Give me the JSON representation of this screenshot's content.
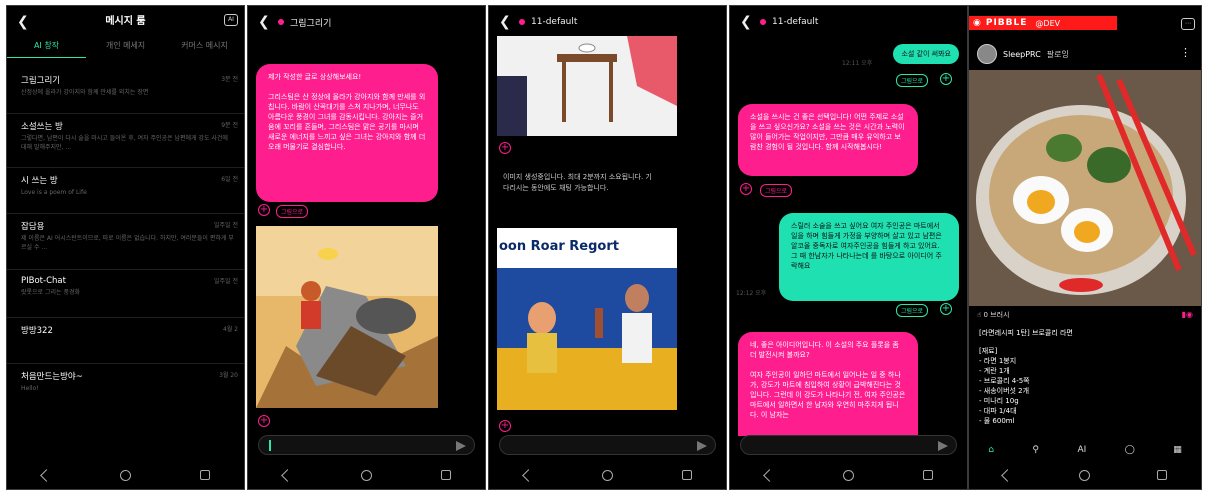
{
  "phone1": {
    "title": "메시지 룸",
    "ai_icon_label": "AI",
    "tabs": [
      "AI 창작",
      "개인 메세지",
      "커머스 메시지"
    ],
    "rooms": [
      {
        "name": "그림그리기",
        "preview": "산정상에 올라가 강아지와 함께 만세를 외치는 장면",
        "time": "3분 전"
      },
      {
        "name": "소설쓰는 방",
        "preview": "그렇다면, 남편이 다시 술을 마시고 들어온 후, 여자 주인공은 남편에게 강도 사건에 대해 말해주지만, ...",
        "time": "9분 전"
      },
      {
        "name": "시 쓰는 방",
        "preview": "Love is a poem of Life",
        "time": "6일 전"
      },
      {
        "name": "잡담용",
        "preview": "제 이름은 AI 어시스턴트이므로, 따로 이름은 없습니다. 하지만, 여러분들이 편하게 부르실 수 ...",
        "time": "일주일 전"
      },
      {
        "name": "PIBot-Chat",
        "preview": "랏롯으로 그리는 풍경화",
        "time": "일주일 전"
      },
      {
        "name": "방방322",
        "preview": "",
        "time": "4월 2"
      },
      {
        "name": "처음만드는방야~",
        "preview": "Hello!",
        "time": "3월 20"
      }
    ]
  },
  "phone2": {
    "title": "그림그리기",
    "bubble": "제가 작성한 글로 상상해보세요!\n\n그리스팀은 산 정상에 올라가 강아지와 함께 만세를 외칩니다. 바람이 산꼭대기를 스쳐 지나가며, 너무나도 아름다운 풍경이 그녀를 감동시킵니다. 강아지는 즐거움에 꼬리를 흔들며, 그리스팀은 맑은 공기를 마시며 새로운 에너지를 느끼고 싶은 그녀는 강아지와 함께 더 오래 머물기로 결심합니다.",
    "chip": "그림으로"
  },
  "phone3": {
    "title": "11-default",
    "generating": "이미지 생성중입니다. 최대 2분까지 소요됩니다. 기다리시는 동안에도 채팅 가능합니다.",
    "poster_title": "oon Roar Regort"
  },
  "phone4": {
    "title": "11-default",
    "user1": "소설 같이 써봐요",
    "time1": "12:11 오후",
    "chip": "그림으로",
    "bot1": "소설을 쓰시는 건 좋은 선택입니다! 어떤 주제로 소설을 쓰고 싶으신가요? 소설을 쓰는 것은 시간과 노력이 많이 들어가는 작업이지만, 그만큼 매우 유익하고 보람찬 경험이 될 것입니다. 함께 시작해봅시다!",
    "user2": "스릴러 소술을 쓰고 싶어요 여자 주인공은 마트에서 일을 하며 힘들게 가정을 부양하며 살고 있고 남편은 알코올 중독자로 여자주인공을 힘들게 하고 있어요. 그 때 한남자가 나타나는데 를 바탕으로 아이디어 주락해요",
    "time2": "12:12 오후",
    "bot2": "네, 좋은 아이디어입니다. 이 소설의 주요 플롯을 좀 더 발전시켜 볼까요?\n\n여자 주인공이 일하던 마트에서 일어나는 일 중 하나가, 강도가 마트에 침입하여 상황이 급박해진다는 것입니다. 그런데 이 강도가 나타나기 전, 여자 주인공은 마트에서 일하면서 한 남자와 우연히 마주치게 됩니다. 이 남자는"
  },
  "phone5": {
    "brand": "PIBBLE",
    "dev": "@DEV",
    "username": "SleepPRC",
    "follow": "팔로잉",
    "likes": "0 브러시",
    "recipe_title": "[라면레시피 1탄] 브로콜리 라면",
    "ingredients_header": "[재료]",
    "ingredients": [
      "- 라면 1봉지",
      "- 계란 1개",
      "- 브로콜리 4-5쪽",
      "- 새송이버섯 2개",
      "- 미나리 10g",
      "- 대파 1/4대",
      "- 물 600ml"
    ],
    "nav_ai": "AI"
  },
  "colors": {
    "pink": "#ff1e8e",
    "teal": "#1fe0b0",
    "red": "#ff1a1a"
  }
}
